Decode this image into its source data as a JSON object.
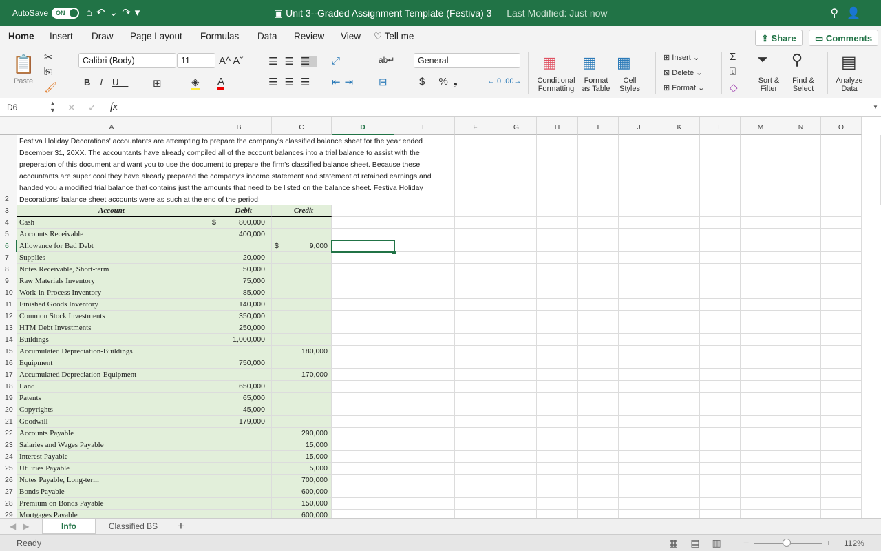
{
  "titlebar": {
    "autosave": "AutoSave",
    "toggle": "ON",
    "document": "Unit 3--Graded Assignment Template (Festiva) 3",
    "modified": "— Last Modified: Just now"
  },
  "tabs": [
    "Home",
    "Insert",
    "Draw",
    "Page Layout",
    "Formulas",
    "Data",
    "Review",
    "View",
    "Tell me"
  ],
  "share": "Share",
  "comments": "Comments",
  "ribbon": {
    "paste": "Paste",
    "font": "Calibri (Body)",
    "size": "11",
    "number_format": "General",
    "conditional": "Conditional Formatting",
    "format_table": "Format as Table",
    "cell_styles": "Cell Styles",
    "insert": "Insert",
    "delete": "Delete",
    "format": "Format",
    "sort": "Sort & Filter",
    "find": "Find & Select",
    "analyze": "Analyze Data"
  },
  "formula_bar": {
    "name_box": "D6",
    "fx": "fx",
    "value": ""
  },
  "columns": [
    "A",
    "B",
    "C",
    "D",
    "E",
    "F",
    "G",
    "H",
    "I",
    "J",
    "K",
    "L",
    "M",
    "N",
    "O"
  ],
  "intro": "Festiva Holiday Decorations' accountants are attempting to prepare the company's classified balance sheet for the year ended December 31, 20XX.  The accountants have already compiled all of the account balances into a trial balance to assist with the preperation of this document and want you to use the document to prepare the firm's classified balance sheet.  Because these accountants are super cool they have already prepared the company's income statement and statement of retained earnings and handed you a modified trial balance that contains just the amounts that need to be listed on the balance sheet.  Festiva Holiday Decorations' balance sheet accounts were as such at the end of the period:",
  "header": {
    "account": "Account",
    "debit": "Debit",
    "credit": "Credit"
  },
  "rows": [
    {
      "n": "4",
      "a": "Cash",
      "ds": "$",
      "d": "800,000",
      "cs": "",
      "c": ""
    },
    {
      "n": "5",
      "a": "Accounts Receivable",
      "ds": "",
      "d": "400,000",
      "cs": "",
      "c": ""
    },
    {
      "n": "6",
      "a": "Allowance for Bad Debt",
      "ds": "",
      "d": "",
      "cs": "$",
      "c": "9,000"
    },
    {
      "n": "7",
      "a": "Supplies",
      "ds": "",
      "d": "20,000",
      "cs": "",
      "c": ""
    },
    {
      "n": "8",
      "a": "Notes Receivable, Short-term",
      "ds": "",
      "d": "50,000",
      "cs": "",
      "c": ""
    },
    {
      "n": "9",
      "a": "Raw Materials Inventory",
      "ds": "",
      "d": "75,000",
      "cs": "",
      "c": ""
    },
    {
      "n": "10",
      "a": "Work-in-Process Inventory",
      "ds": "",
      "d": "85,000",
      "cs": "",
      "c": ""
    },
    {
      "n": "11",
      "a": "Finished Goods Inventory",
      "ds": "",
      "d": "140,000",
      "cs": "",
      "c": ""
    },
    {
      "n": "12",
      "a": "Common Stock Investments",
      "ds": "",
      "d": "350,000",
      "cs": "",
      "c": ""
    },
    {
      "n": "13",
      "a": "HTM Debt Investments",
      "ds": "",
      "d": "250,000",
      "cs": "",
      "c": ""
    },
    {
      "n": "14",
      "a": "Buildings",
      "ds": "",
      "d": "1,000,000",
      "cs": "",
      "c": ""
    },
    {
      "n": "15",
      "a": "Accumulated Depreciation-Buildings",
      "ds": "",
      "d": "",
      "cs": "",
      "c": "180,000"
    },
    {
      "n": "16",
      "a": "Equipment",
      "ds": "",
      "d": "750,000",
      "cs": "",
      "c": ""
    },
    {
      "n": "17",
      "a": "Accumulated Depreciation-Equipment",
      "ds": "",
      "d": "",
      "cs": "",
      "c": "170,000"
    },
    {
      "n": "18",
      "a": "Land",
      "ds": "",
      "d": "650,000",
      "cs": "",
      "c": ""
    },
    {
      "n": "19",
      "a": "Patents",
      "ds": "",
      "d": "65,000",
      "cs": "",
      "c": ""
    },
    {
      "n": "20",
      "a": "Copyrights",
      "ds": "",
      "d": "45,000",
      "cs": "",
      "c": ""
    },
    {
      "n": "21",
      "a": "Goodwill",
      "ds": "",
      "d": "179,000",
      "cs": "",
      "c": ""
    },
    {
      "n": "22",
      "a": "Accounts Payable",
      "ds": "",
      "d": "",
      "cs": "",
      "c": "290,000"
    },
    {
      "n": "23",
      "a": "Salaries and Wages Payable",
      "ds": "",
      "d": "",
      "cs": "",
      "c": "15,000"
    },
    {
      "n": "24",
      "a": "Interest Payable",
      "ds": "",
      "d": "",
      "cs": "",
      "c": "15,000"
    },
    {
      "n": "25",
      "a": "Utilities Payable",
      "ds": "",
      "d": "",
      "cs": "",
      "c": "5,000"
    },
    {
      "n": "26",
      "a": "Notes Payable, Long-term",
      "ds": "",
      "d": "",
      "cs": "",
      "c": "700,000"
    },
    {
      "n": "27",
      "a": "Bonds Payable",
      "ds": "",
      "d": "",
      "cs": "",
      "c": "600,000"
    },
    {
      "n": "28",
      "a": "Premium on Bonds Payable",
      "ds": "",
      "d": "",
      "cs": "",
      "c": "150,000"
    },
    {
      "n": "29",
      "a": "Mortgages Payable",
      "ds": "",
      "d": "",
      "cs": "",
      "c": "600,000"
    }
  ],
  "sheets": [
    "Info",
    "Classified BS"
  ],
  "add_sheet": "+",
  "status": {
    "ready": "Ready",
    "zoom": "112%"
  },
  "colors": {
    "accent": "#217346",
    "fill": "#e2efda"
  }
}
